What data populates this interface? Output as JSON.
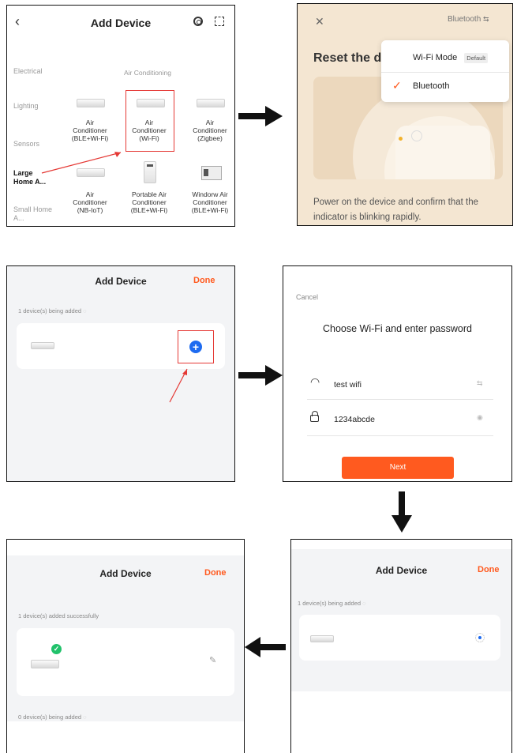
{
  "panel1": {
    "title": "Add Device",
    "sidebar": [
      "Electrical",
      "Lighting",
      "Sensors",
      "Large Home A...",
      "Small Home A..."
    ],
    "category": "Air Conditioning",
    "devices": [
      {
        "l1": "Air",
        "l2": "Conditioner",
        "l3": "(BLE+Wi-Fi)"
      },
      {
        "l1": "Air",
        "l2": "Conditioner",
        "l3": "(Wi-Fi)"
      },
      {
        "l1": "Air",
        "l2": "Conditioner",
        "l3": "(Zigbee)"
      },
      {
        "l1": "Air",
        "l2": "Conditioner",
        "l3": "(NB-IoT)"
      },
      {
        "l1": "Portable Air",
        "l2": "Conditioner",
        "l3": "(BLE+Wi-Fi)"
      },
      {
        "l1": "Windorw Air",
        "l2": "Conditioner",
        "l3": "(BLE+Wi-Fi)"
      }
    ]
  },
  "panel2": {
    "close": "✕",
    "mode_label": "Bluetooth",
    "heading": "Reset the d",
    "menu": {
      "wifi": "Wi-Fi Mode",
      "default_badge": "Default",
      "bluetooth": "Bluetooth"
    },
    "instruction_1": "Power on the device and confirm that the",
    "instruction_2": "indicator is blinking rapidly."
  },
  "panel3": {
    "title": "Add Device",
    "done": "Done",
    "status": "1 device(s) being added"
  },
  "panel4": {
    "cancel": "Cancel",
    "heading": "Choose Wi-Fi and enter password",
    "ssid": "test wifi",
    "password": "1234abcde",
    "next": "Next"
  },
  "panel5": {
    "title": "Add Device",
    "done": "Done",
    "status": "1 device(s) being added"
  },
  "panel6": {
    "title": "Add Device",
    "done": "Done",
    "success": "1 device(s) added successfully",
    "pending": "0 device(s) being added"
  },
  "colors": {
    "accent": "#ff5a1f",
    "highlight": "#e53935",
    "blue": "#1e6bf0",
    "green": "#21c26b"
  }
}
